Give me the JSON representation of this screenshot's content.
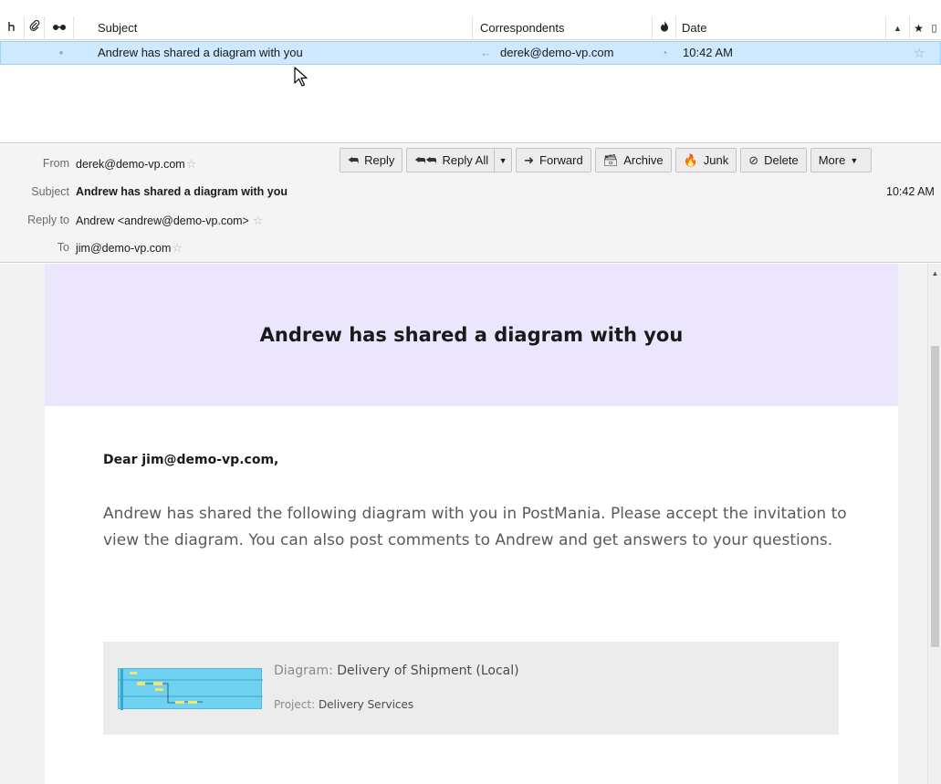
{
  "list": {
    "headers": {
      "thread_icon": "thread-icon",
      "attachment_icon": "paperclip-icon",
      "read_icon": "glasses-icon",
      "subject": "Subject",
      "correspondents": "Correspondents",
      "junk_icon": "flame-icon",
      "date": "Date",
      "sort_icon": "sort-ascending-icon",
      "star_icon": "star-icon"
    },
    "messages": [
      {
        "unread_dot": "•",
        "subject": "Andrew has shared a diagram with you",
        "correspondent_arrow": "←",
        "correspondent": "derek@demo-vp.com",
        "date": "10:42 AM",
        "starred": false
      }
    ]
  },
  "header": {
    "from_label": "From",
    "from_value": "derek@demo-vp.com",
    "subject_label": "Subject",
    "subject_value": "Andrew has shared a diagram with you",
    "reply_to_label": "Reply to",
    "reply_to_value": "Andrew <andrew@demo-vp.com>",
    "to_label": "To",
    "to_value": "jim@demo-vp.com",
    "time": "10:42 AM",
    "star_glyph": "☆",
    "toolbar": {
      "reply": "Reply",
      "reply_all": "Reply All",
      "forward": "Forward",
      "archive": "Archive",
      "junk": "Junk",
      "delete": "Delete",
      "more": "More"
    }
  },
  "email": {
    "title": "Andrew has shared a diagram with you",
    "greeting": "Dear jim@demo-vp.com,",
    "paragraph": "Andrew has shared the following diagram with you in PostMania. Please accept the invitation to view the diagram. You can also post comments to Andrew and get answers to your questions.",
    "diagram_key": "Diagram:",
    "diagram_value": "Delivery of Shipment (Local)",
    "project_key": "Project:",
    "project_value": "Delivery Services"
  },
  "colors": {
    "selected_row": "#cde8ff",
    "banner": "#ebe6fd",
    "thumbnail": "#6fd2f0"
  }
}
